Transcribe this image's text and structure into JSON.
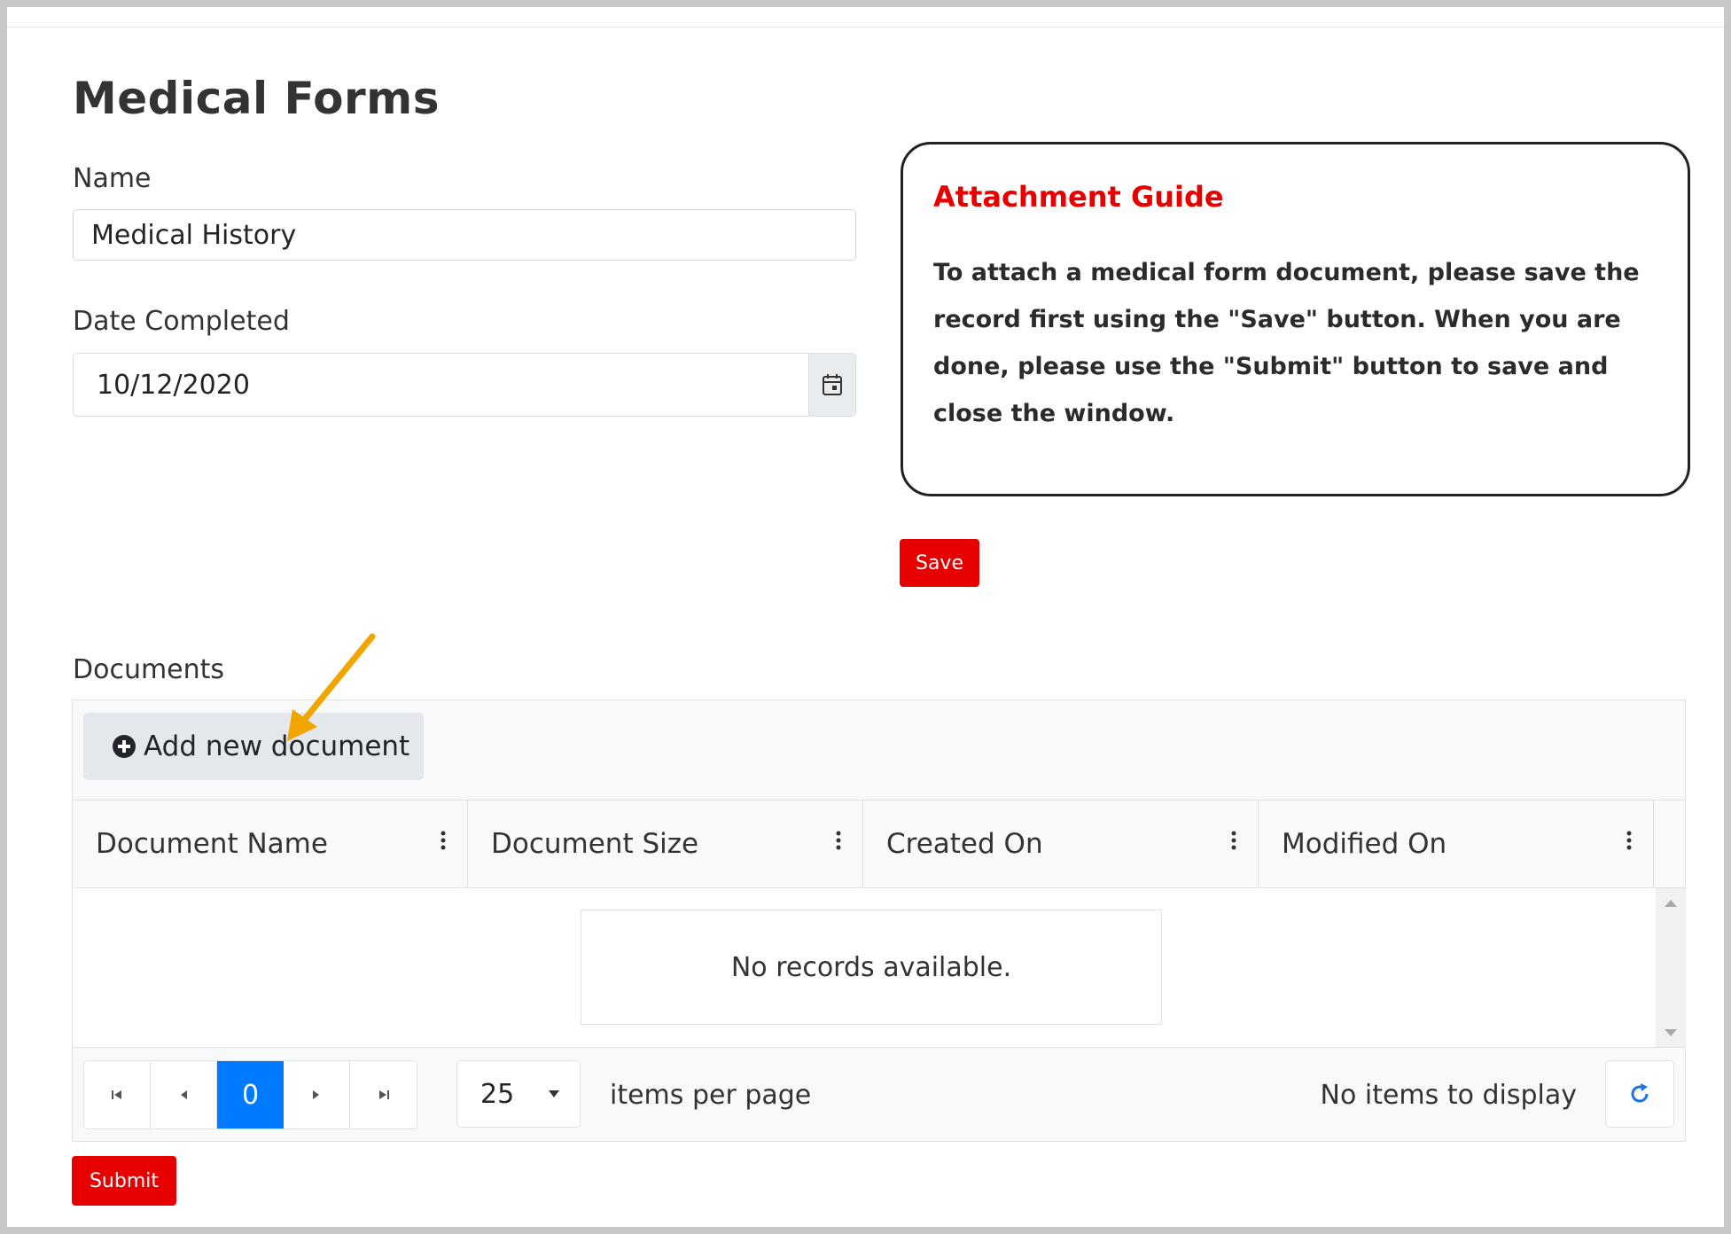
{
  "page": {
    "title": "Medical Forms"
  },
  "form": {
    "name_label": "Name",
    "name_value": "Medical History",
    "date_label": "Date Completed",
    "date_value": "10/12/2020"
  },
  "guide": {
    "title": "Attachment Guide",
    "text": "To attach a medical form document, please save the record first using the \"Save\" button. When you are done, please use the \"Submit\" button to save and close the window."
  },
  "buttons": {
    "save": "Save",
    "submit": "Submit"
  },
  "documents": {
    "label": "Documents",
    "add_button": "Add new document",
    "columns": [
      "Document Name",
      "Document Size",
      "Created On",
      "Modified On"
    ],
    "empty_message": "No records available.",
    "pager": {
      "current_page": "0",
      "page_size": "25",
      "per_page_label": "items per page",
      "info": "No items to display"
    }
  },
  "colors": {
    "accent_red": "#e60000",
    "pager_active": "#007bff",
    "annotation_arrow": "#f0a500"
  }
}
